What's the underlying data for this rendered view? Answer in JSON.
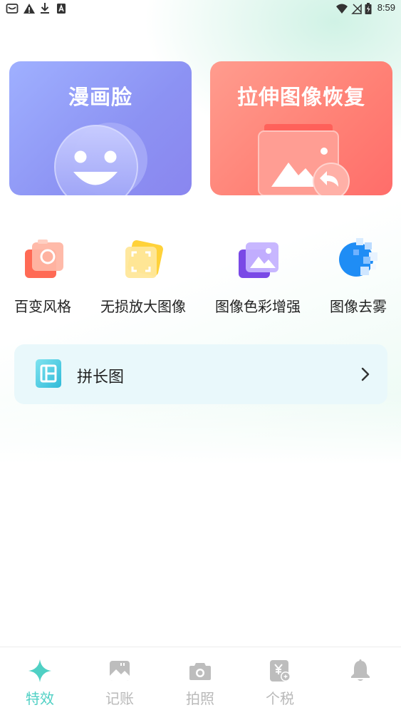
{
  "status_bar": {
    "time": "8:59",
    "left_icons": [
      "mail-icon",
      "warning-icon",
      "download-icon",
      "app-notification-icon"
    ],
    "right_icons": [
      "wifi-icon",
      "no-signal-icon",
      "battery-icon"
    ]
  },
  "cards": [
    {
      "id": "manhua",
      "title": "漫画脸",
      "icon": "smiley-face-icon"
    },
    {
      "id": "stretch",
      "title": "拉伸图像恢复",
      "icon": "image-restore-icon"
    }
  ],
  "features": [
    {
      "label": "百变风格",
      "icon": "camera-style-icon"
    },
    {
      "label": "无损放大图像",
      "icon": "enlarge-image-icon"
    },
    {
      "label": "图像色彩增强",
      "icon": "color-enhance-icon"
    },
    {
      "label": "图像去雾",
      "icon": "dehaze-icon"
    }
  ],
  "long_image": {
    "label": "拼长图",
    "icon": "long-image-icon"
  },
  "bottom_nav": {
    "items": [
      {
        "label": "特效",
        "icon": "sparkle-icon",
        "active": true
      },
      {
        "label": "记账",
        "icon": "ledger-icon",
        "active": false
      },
      {
        "label": "拍照",
        "icon": "camera-icon",
        "active": false
      },
      {
        "label": "个税",
        "icon": "tax-icon",
        "active": false
      },
      {
        "label": "",
        "icon": "bell-icon",
        "active": false
      }
    ]
  },
  "colors": {
    "accent": "#4fd0c4",
    "manhua_card": "#8c92f3",
    "stretch_card": "#ff8075",
    "long_row_bg": "#e9f8fb",
    "nav_inactive": "#b9b9b9"
  }
}
